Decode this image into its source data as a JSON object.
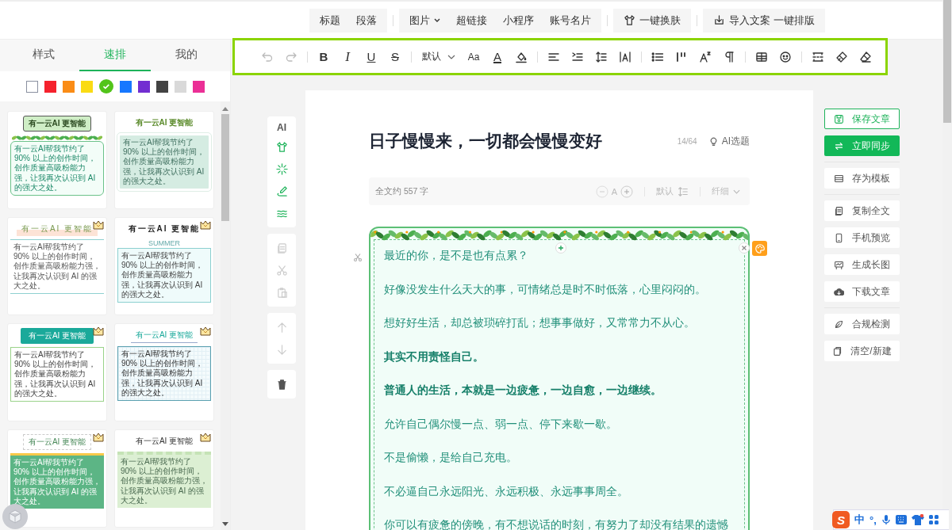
{
  "top_bar": {
    "groups": [
      {
        "items": [
          {
            "label": "标题",
            "kind": "text",
            "dropdown": false
          },
          {
            "label": "段落",
            "kind": "text",
            "dropdown": false
          }
        ]
      },
      {
        "items": [
          {
            "label": "图片",
            "kind": "text",
            "dropdown": true
          },
          {
            "label": "超链接",
            "kind": "text",
            "dropdown": false
          },
          {
            "label": "小程序",
            "kind": "text",
            "dropdown": false
          },
          {
            "label": "账号名片",
            "kind": "text",
            "dropdown": false
          }
        ]
      },
      {
        "items": [
          {
            "label": "一键换肤",
            "kind": "skin",
            "dropdown": false
          }
        ]
      },
      {
        "items": [
          {
            "label": "导入文案 一键排版",
            "kind": "import",
            "dropdown": false
          }
        ]
      }
    ]
  },
  "left_panel": {
    "tabs": [
      {
        "label": "样式",
        "selected": false
      },
      {
        "label": "速排",
        "selected": true
      },
      {
        "label": "我的",
        "selected": false
      }
    ],
    "colors": [
      {
        "color": "#ffffff",
        "selected": false
      },
      {
        "color": "#f5222d",
        "selected": false
      },
      {
        "color": "#fa8c16",
        "selected": false
      },
      {
        "color": "#fadb14",
        "selected": false
      },
      {
        "color": "#52c41a",
        "selected": true
      },
      {
        "color": "#1677ff",
        "selected": false
      },
      {
        "color": "#722ed1",
        "selected": false
      },
      {
        "color": "#434343",
        "selected": false
      },
      {
        "color": "#d9d9d9",
        "selected": false
      },
      {
        "color": "#eb2f96",
        "selected": false
      }
    ],
    "templates": [
      {
        "kind": "leaf-frame",
        "title": "有一云AI 更智能",
        "body": "有一云AI帮我节约了 90% 以上的创作时间，创作质量高吸粉能力强，让我再次认识到 AI 的强大之处。",
        "vip": false
      },
      {
        "kind": "pond",
        "title": "有一云AI 更智能",
        "body": "有一云AI帮我节约了 90% 以上的创作时间，创作质量高吸粉能力强，让我再次认识到 AI 的强大之处。",
        "vip": false
      },
      {
        "kind": "sun-line",
        "title": "有一云AI 更智能",
        "body": "有一云AI帮我节约了 90% 以上的创作时间，创作质量高吸粉能力强，让我再次认识到 AI 的强大之处。",
        "vip": true
      },
      {
        "kind": "summer",
        "title": "有一云AI 更智能",
        "tag": "SUMMER",
        "body": "有一云AI帮我节约了 90% 以上的创作时间，创作质量高吸粉能力强，让我再次认识到 AI 的强大之处。",
        "vip": true
      },
      {
        "kind": "teal-banner",
        "title": "有一云AI 更智能",
        "body": "有一云AI帮我节约了 90% 以上的创作时间，创作质量高吸粉能力强，让我再次认识到 AI 的强大之处。",
        "vip": true
      },
      {
        "kind": "grid-paper",
        "title": "有一云AI 更智能",
        "body": "有一云AI帮我节约了 90% 以上的创作时间，创作质量高吸粉能力强，让我再次认识到 AI 的强大之处。",
        "vip": true
      },
      {
        "kind": "green-block",
        "title": "有一云AI 更智能",
        "body": "有一云AI帮我节约了 90% 以上的创作时间，创作质量高吸粉能力强，让我再次认识到 AI 的强大之处。",
        "vip": true
      },
      {
        "kind": "stripes",
        "title": "有一云AI 更智能",
        "body": "有一云AI帮我节约了 90% 以上的创作时间，创作质量高吸粉能力强，让我再次认识到 AI 的强大之处。",
        "vip": true
      }
    ]
  },
  "toolbar": {
    "groups": [
      {
        "items": [
          {
            "kind": "undo",
            "disabled": true
          },
          {
            "kind": "redo",
            "disabled": true
          }
        ]
      },
      {
        "items": [
          {
            "kind": "bold",
            "glyph": "B",
            "disabled": false
          },
          {
            "kind": "italic",
            "glyph": "I",
            "disabled": false
          },
          {
            "kind": "underline",
            "glyph": "U",
            "disabled": false
          },
          {
            "kind": "strike",
            "glyph": "S",
            "disabled": false
          }
        ]
      },
      {
        "items": [
          {
            "kind": "font-select",
            "label": "默认",
            "disabled": false
          },
          {
            "kind": "font-size",
            "glyph": "Aa",
            "disabled": false
          },
          {
            "kind": "font-color",
            "glyph": "A",
            "disabled": false
          },
          {
            "kind": "fill-color",
            "disabled": false
          }
        ]
      },
      {
        "items": [
          {
            "kind": "align",
            "disabled": false
          },
          {
            "kind": "indent",
            "disabled": false
          },
          {
            "kind": "line-height",
            "disabled": false
          },
          {
            "kind": "letter-spacing",
            "disabled": false
          }
        ]
      },
      {
        "items": [
          {
            "kind": "list",
            "disabled": false
          },
          {
            "kind": "quote",
            "disabled": false
          },
          {
            "kind": "superscript",
            "disabled": false
          },
          {
            "kind": "paragraph",
            "disabled": false
          }
        ]
      },
      {
        "items": [
          {
            "kind": "table",
            "disabled": false
          },
          {
            "kind": "emoji",
            "disabled": false
          }
        ]
      },
      {
        "items": [
          {
            "kind": "divider",
            "disabled": false
          },
          {
            "kind": "brush",
            "disabled": false
          },
          {
            "kind": "eraser",
            "disabled": false
          }
        ]
      }
    ]
  },
  "side_tools": {
    "groups": [
      {
        "items": [
          {
            "kind": "ai",
            "label": "AI",
            "disabled": false
          },
          {
            "kind": "shirt",
            "disabled": false
          },
          {
            "kind": "sparkle",
            "disabled": false
          },
          {
            "kind": "pen",
            "disabled": false
          },
          {
            "kind": "waves",
            "disabled": false
          }
        ]
      },
      {
        "items": [
          {
            "kind": "copy",
            "disabled": true
          },
          {
            "kind": "scissors",
            "disabled": true
          },
          {
            "kind": "paste",
            "disabled": true
          }
        ]
      },
      {
        "items": [
          {
            "kind": "up",
            "disabled": true
          },
          {
            "kind": "down",
            "disabled": true
          }
        ]
      },
      {
        "items": [
          {
            "kind": "trash",
            "disabled": false
          }
        ]
      }
    ]
  },
  "editor": {
    "title": "日子慢慢来，一切都会慢慢变好",
    "title_count": "14/64",
    "ai_topic": "AI选题",
    "stats": {
      "word_count": "全文约 557 字",
      "font_label": "A",
      "line_height": "默认",
      "weight": "纤细"
    },
    "paragraphs": [
      {
        "text": "最近的你，是不是也有点累？",
        "bold": false
      },
      {
        "text": "好像没发生什么天大的事，可情绪总是时不时低落，心里闷闷的。",
        "bold": false
      },
      {
        "text": "想好好生活，却总被琐碎打乱；想事事做好，又常常力不从心。",
        "bold": false
      },
      {
        "text": "其实不用责怪自己。",
        "bold": true
      },
      {
        "text": "普通人的生活，本就是一边疲惫，一边自愈，一边继续。",
        "bold": true
      },
      {
        "text": "允许自己偶尔慢一点、弱一点、停下来歇一歇。",
        "bold": false
      },
      {
        "text": "不是偷懒，是给自己充电。",
        "bold": false
      },
      {
        "text": "不必逼自己永远阳光、永远积极、永远事事周全。",
        "bold": false
      },
      {
        "text": "你可以有疲惫的傍晚，有不想说话的时刻，有努力了却没有结果的遗憾",
        "bold": false
      }
    ]
  },
  "actions": {
    "groups": [
      {
        "items": [
          {
            "label": "保存文章",
            "kind": "save"
          },
          {
            "label": "立即同步",
            "kind": "sync"
          }
        ]
      },
      {
        "items": [
          {
            "label": "存为模板",
            "kind": "template"
          }
        ]
      },
      {
        "items": [
          {
            "label": "复制全文",
            "kind": "copy"
          },
          {
            "label": "手机预览",
            "kind": "phone"
          },
          {
            "label": "生成长图",
            "kind": "image"
          },
          {
            "label": "下载文章",
            "kind": "download"
          }
        ]
      },
      {
        "items": [
          {
            "label": "合规检测",
            "kind": "check"
          },
          {
            "label": "清空/新建",
            "kind": "new"
          }
        ]
      }
    ]
  },
  "ime": {
    "logo": "S",
    "mode": "中",
    "punct": "°,"
  }
}
